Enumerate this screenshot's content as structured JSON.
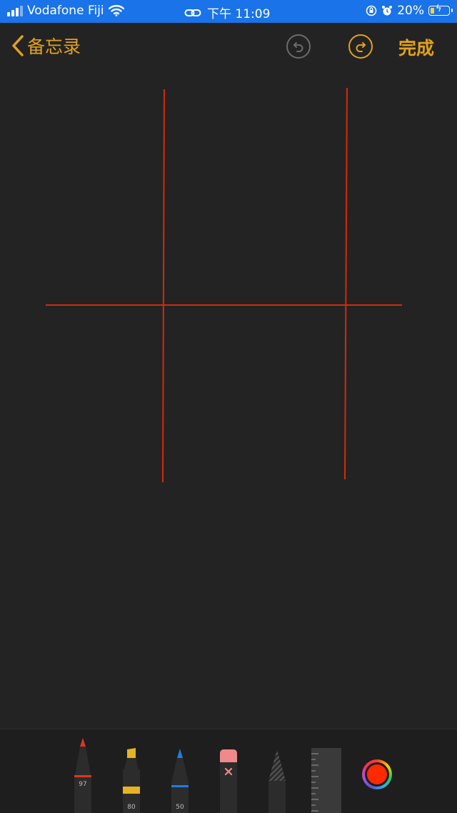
{
  "status_bar": {
    "carrier": "Vodafone Fiji",
    "time": "下午 11:09",
    "battery_percent": "20%",
    "battery_level": 0.2
  },
  "nav": {
    "back_label": "备忘录",
    "done_label": "完成"
  },
  "canvas": {
    "stroke_color": "#d42a0c",
    "background_color": "#232324"
  },
  "tools": {
    "pen": {
      "name": "pen-tool",
      "color": "#e0351e",
      "label": "97"
    },
    "marker": {
      "name": "marker-tool",
      "color": "#e6b422",
      "label": "80"
    },
    "pencil": {
      "name": "pencil-tool",
      "color": "#1e7de0",
      "label": "50"
    },
    "eraser": {
      "name": "eraser-tool",
      "color": "#f08a8a"
    },
    "lasso": {
      "name": "lasso-tool"
    },
    "ruler": {
      "name": "ruler-tool"
    }
  },
  "colors": {
    "accent": "#e3a21a",
    "status_bar": "#1a73e8",
    "selected_color": "#ff2a00"
  }
}
